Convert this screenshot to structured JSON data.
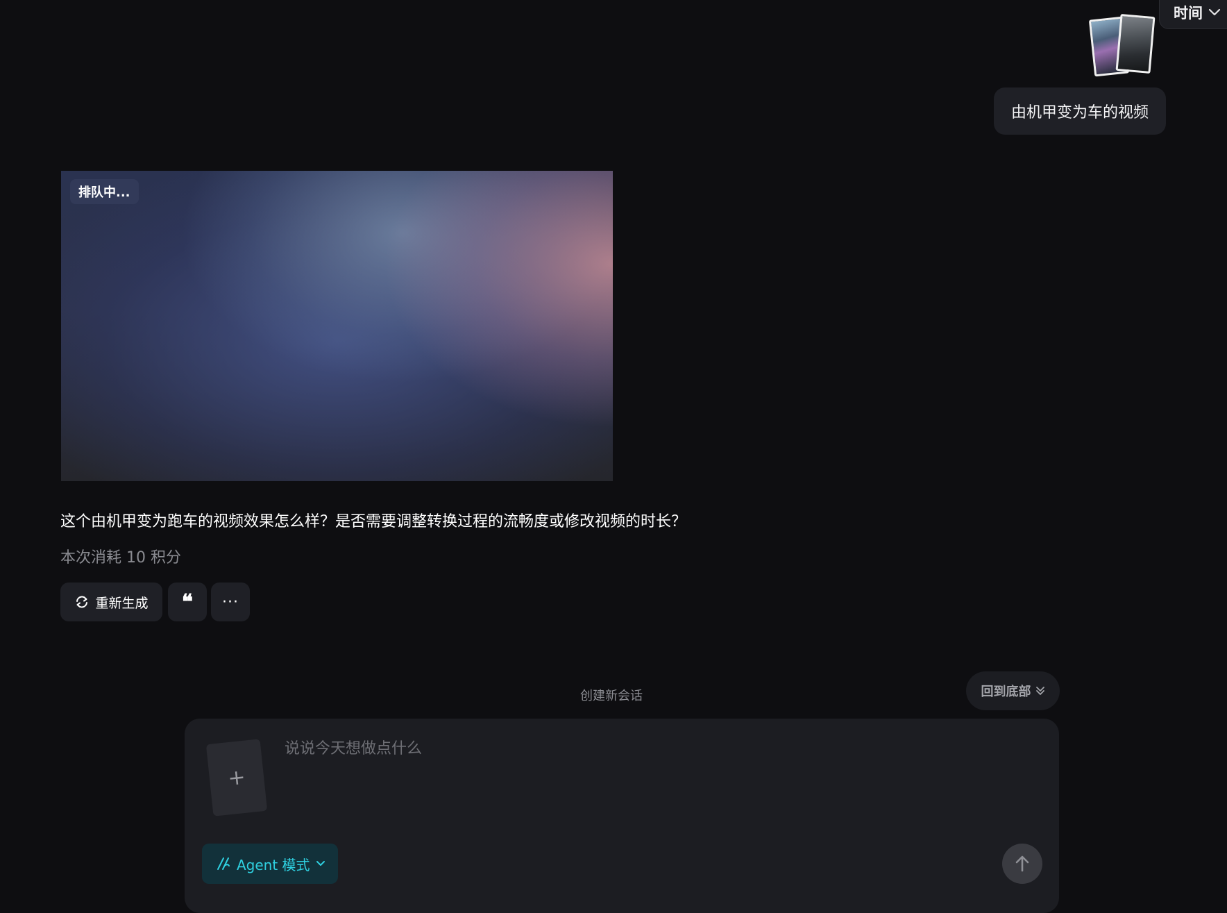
{
  "header": {
    "sort_label": "时间"
  },
  "conversation": {
    "user_message": "由机甲变为车的视频",
    "video": {
      "status_badge": "排队中..."
    },
    "assistant_message": "这个由机甲变为跑车的视频效果怎么样？是否需要调整转换过程的流畅度或修改视频的时长？",
    "cost_note": "本次消耗 10 积分",
    "actions": {
      "regenerate_label": "重新生成",
      "quote_glyph": "❝",
      "more_glyph": "···"
    }
  },
  "footer": {
    "new_session_label": "创建新会话",
    "back_to_bottom_label": "回到底部"
  },
  "composer": {
    "placeholder": "说说今天想做点什么",
    "value": "",
    "upload_glyph": "+",
    "mode_label": "Agent 模式"
  },
  "colors": {
    "accent": "#2fd0e0",
    "background": "#0e0e11",
    "surface": "#1f2026"
  }
}
